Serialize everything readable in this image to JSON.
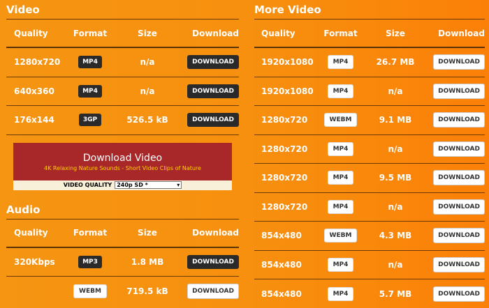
{
  "video": {
    "title": "Video",
    "headers": {
      "quality": "Quality",
      "format": "Format",
      "size": "Size",
      "download": "Download"
    },
    "rows": [
      {
        "quality": "1280x720",
        "format": "MP4",
        "size": "n/a",
        "button": "DOWNLOAD"
      },
      {
        "quality": "640x360",
        "format": "MP4",
        "size": "n/a",
        "button": "DOWNLOAD"
      },
      {
        "quality": "176x144",
        "format": "3GP",
        "size": "526.5 kB",
        "button": "DOWNLOAD"
      }
    ]
  },
  "ad": {
    "title": "Download Video",
    "subtitle": "4K Relaxing Nature Sounds - Short Video Clips of Nature",
    "quality_label": "VIDEO QUALITY",
    "quality_value": "240p SD *"
  },
  "audio": {
    "title": "Audio",
    "headers": {
      "quality": "Quality",
      "format": "Format",
      "size": "Size",
      "download": "Download"
    },
    "rows": [
      {
        "quality": "320Kbps",
        "format": "MP3",
        "size": "1.8 MB",
        "button": "DOWNLOAD"
      },
      {
        "quality": "",
        "format": "WEBM",
        "size": "719.5 kB",
        "button": "DOWNLOAD"
      }
    ]
  },
  "more_video": {
    "title": "More Video",
    "headers": {
      "quality": "Quality",
      "format": "Format",
      "size": "Size",
      "download": "Download"
    },
    "rows": [
      {
        "quality": "1920x1080",
        "format": "MP4",
        "size": "26.7 MB",
        "button": "DOWNLOAD"
      },
      {
        "quality": "1920x1080",
        "format": "MP4",
        "size": "n/a",
        "button": "DOWNLOAD"
      },
      {
        "quality": "1280x720",
        "format": "WEBM",
        "size": "9.1 MB",
        "button": "DOWNLOAD"
      },
      {
        "quality": "1280x720",
        "format": "MP4",
        "size": "n/a",
        "button": "DOWNLOAD"
      },
      {
        "quality": "1280x720",
        "format": "MP4",
        "size": "9.5 MB",
        "button": "DOWNLOAD"
      },
      {
        "quality": "1280x720",
        "format": "MP4",
        "size": "n/a",
        "button": "DOWNLOAD"
      },
      {
        "quality": "854x480",
        "format": "WEBM",
        "size": "4.3 MB",
        "button": "DOWNLOAD"
      },
      {
        "quality": "854x480",
        "format": "MP4",
        "size": "n/a",
        "button": "DOWNLOAD"
      },
      {
        "quality": "854x480",
        "format": "MP4",
        "size": "5.7 MB",
        "button": "DOWNLOAD"
      }
    ]
  }
}
